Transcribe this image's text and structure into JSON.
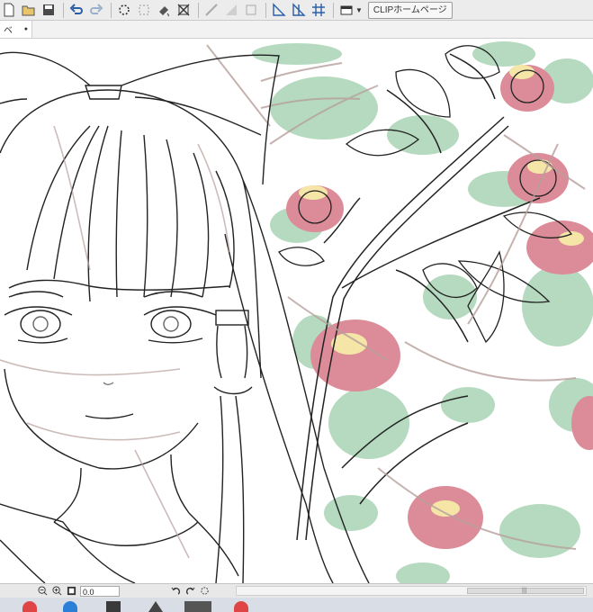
{
  "toolbar": {
    "clip_button_label": "CLIPホームページ",
    "icons": [
      "new-icon",
      "open-icon",
      "save-icon",
      "undo-icon",
      "redo-icon",
      "selection-launcher-icon",
      "transform-icon",
      "fill-icon",
      "crop-icon",
      "snap-ruler-icon",
      "snap-grid-icon",
      "snap-special-icon",
      "perspective-icon",
      "symmetry-icon",
      "grid-icon",
      "screen-layout-icon"
    ]
  },
  "tab": {
    "label": "ベ",
    "marker": "●"
  },
  "statusbar": {
    "zoom_value": "0.0",
    "grip": "|||"
  },
  "colors": {
    "toolbar_bg": "#ececec",
    "leaf_green": "#a9d4b4",
    "flower_pink": "#dc8c98",
    "flower_yellow": "#f5e6a8",
    "sketch_brown": "#b7a09c"
  }
}
